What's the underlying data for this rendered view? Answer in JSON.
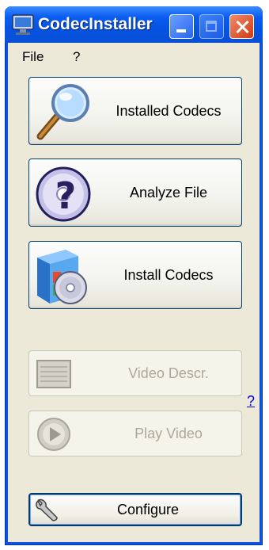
{
  "window": {
    "title": "CodecInstaller"
  },
  "menu": {
    "file": "File",
    "help": "?"
  },
  "buttons": {
    "installed_codecs": "Installed Codecs",
    "analyze_file": "Analyze File",
    "install_codecs": "Install Codecs",
    "video_descr": "Video Descr.",
    "play_video": "Play Video",
    "configure": "Configure"
  },
  "help_link": "?",
  "icons": {
    "app": "monitor-icon",
    "installed_codecs": "magnifier-icon",
    "analyze_file": "disc-question-icon",
    "install_codecs": "software-box-icon",
    "video_descr": "document-list-icon",
    "play_video": "play-icon",
    "configure": "wrench-icon"
  },
  "colors": {
    "titlebar": "#0a5cf0",
    "client_bg": "#ece9d8",
    "button_border": "#003c74",
    "disabled_text": "#aca899",
    "close_button": "#d23a12"
  }
}
